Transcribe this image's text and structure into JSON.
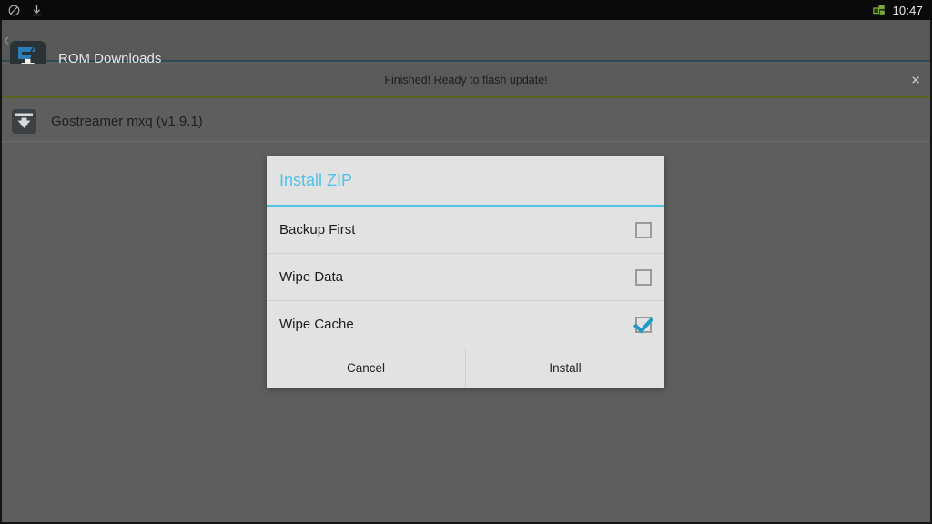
{
  "statusbar": {
    "icons": [
      {
        "name": "rotation-lock-icon"
      },
      {
        "name": "download-icon"
      },
      {
        "name": "multi-window-icon"
      }
    ],
    "clock": "10:47",
    "accent_green": "#8cc63f"
  },
  "titlebar": {
    "back_label": "‹",
    "app_name": "ROM Downloads",
    "app_icon": "gostreamer-download-icon",
    "accent_underline": "#2d4a55"
  },
  "notice": {
    "message": "Finished! Ready to flash update!",
    "close_label": "×",
    "accent_line": "#55651f"
  },
  "rom_list": {
    "items": [
      {
        "label": "Gostreamer mxq (v1.9.1)",
        "icon": "download-box-icon"
      }
    ]
  },
  "dialog": {
    "title": "Install ZIP",
    "title_color": "#4fc3e8",
    "options": [
      {
        "label": "Backup First",
        "checked": false
      },
      {
        "label": "Wipe Data",
        "checked": false
      },
      {
        "label": "Wipe Cache",
        "checked": true
      }
    ],
    "buttons": {
      "cancel": "Cancel",
      "install": "Install"
    }
  }
}
